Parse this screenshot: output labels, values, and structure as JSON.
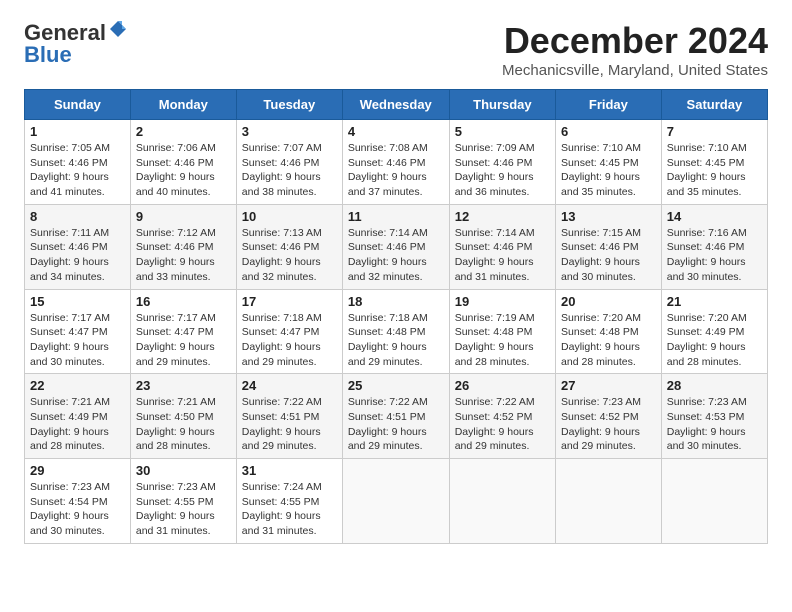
{
  "logo": {
    "general": "General",
    "blue": "Blue"
  },
  "title": "December 2024",
  "subtitle": "Mechanicsville, Maryland, United States",
  "days_of_week": [
    "Sunday",
    "Monday",
    "Tuesday",
    "Wednesday",
    "Thursday",
    "Friday",
    "Saturday"
  ],
  "weeks": [
    [
      {
        "num": "1",
        "sunrise": "Sunrise: 7:05 AM",
        "sunset": "Sunset: 4:46 PM",
        "daylight": "Daylight: 9 hours and 41 minutes."
      },
      {
        "num": "2",
        "sunrise": "Sunrise: 7:06 AM",
        "sunset": "Sunset: 4:46 PM",
        "daylight": "Daylight: 9 hours and 40 minutes."
      },
      {
        "num": "3",
        "sunrise": "Sunrise: 7:07 AM",
        "sunset": "Sunset: 4:46 PM",
        "daylight": "Daylight: 9 hours and 38 minutes."
      },
      {
        "num": "4",
        "sunrise": "Sunrise: 7:08 AM",
        "sunset": "Sunset: 4:46 PM",
        "daylight": "Daylight: 9 hours and 37 minutes."
      },
      {
        "num": "5",
        "sunrise": "Sunrise: 7:09 AM",
        "sunset": "Sunset: 4:46 PM",
        "daylight": "Daylight: 9 hours and 36 minutes."
      },
      {
        "num": "6",
        "sunrise": "Sunrise: 7:10 AM",
        "sunset": "Sunset: 4:45 PM",
        "daylight": "Daylight: 9 hours and 35 minutes."
      },
      {
        "num": "7",
        "sunrise": "Sunrise: 7:10 AM",
        "sunset": "Sunset: 4:45 PM",
        "daylight": "Daylight: 9 hours and 35 minutes."
      }
    ],
    [
      {
        "num": "8",
        "sunrise": "Sunrise: 7:11 AM",
        "sunset": "Sunset: 4:46 PM",
        "daylight": "Daylight: 9 hours and 34 minutes."
      },
      {
        "num": "9",
        "sunrise": "Sunrise: 7:12 AM",
        "sunset": "Sunset: 4:46 PM",
        "daylight": "Daylight: 9 hours and 33 minutes."
      },
      {
        "num": "10",
        "sunrise": "Sunrise: 7:13 AM",
        "sunset": "Sunset: 4:46 PM",
        "daylight": "Daylight: 9 hours and 32 minutes."
      },
      {
        "num": "11",
        "sunrise": "Sunrise: 7:14 AM",
        "sunset": "Sunset: 4:46 PM",
        "daylight": "Daylight: 9 hours and 32 minutes."
      },
      {
        "num": "12",
        "sunrise": "Sunrise: 7:14 AM",
        "sunset": "Sunset: 4:46 PM",
        "daylight": "Daylight: 9 hours and 31 minutes."
      },
      {
        "num": "13",
        "sunrise": "Sunrise: 7:15 AM",
        "sunset": "Sunset: 4:46 PM",
        "daylight": "Daylight: 9 hours and 30 minutes."
      },
      {
        "num": "14",
        "sunrise": "Sunrise: 7:16 AM",
        "sunset": "Sunset: 4:46 PM",
        "daylight": "Daylight: 9 hours and 30 minutes."
      }
    ],
    [
      {
        "num": "15",
        "sunrise": "Sunrise: 7:17 AM",
        "sunset": "Sunset: 4:47 PM",
        "daylight": "Daylight: 9 hours and 30 minutes."
      },
      {
        "num": "16",
        "sunrise": "Sunrise: 7:17 AM",
        "sunset": "Sunset: 4:47 PM",
        "daylight": "Daylight: 9 hours and 29 minutes."
      },
      {
        "num": "17",
        "sunrise": "Sunrise: 7:18 AM",
        "sunset": "Sunset: 4:47 PM",
        "daylight": "Daylight: 9 hours and 29 minutes."
      },
      {
        "num": "18",
        "sunrise": "Sunrise: 7:18 AM",
        "sunset": "Sunset: 4:48 PM",
        "daylight": "Daylight: 9 hours and 29 minutes."
      },
      {
        "num": "19",
        "sunrise": "Sunrise: 7:19 AM",
        "sunset": "Sunset: 4:48 PM",
        "daylight": "Daylight: 9 hours and 28 minutes."
      },
      {
        "num": "20",
        "sunrise": "Sunrise: 7:20 AM",
        "sunset": "Sunset: 4:48 PM",
        "daylight": "Daylight: 9 hours and 28 minutes."
      },
      {
        "num": "21",
        "sunrise": "Sunrise: 7:20 AM",
        "sunset": "Sunset: 4:49 PM",
        "daylight": "Daylight: 9 hours and 28 minutes."
      }
    ],
    [
      {
        "num": "22",
        "sunrise": "Sunrise: 7:21 AM",
        "sunset": "Sunset: 4:49 PM",
        "daylight": "Daylight: 9 hours and 28 minutes."
      },
      {
        "num": "23",
        "sunrise": "Sunrise: 7:21 AM",
        "sunset": "Sunset: 4:50 PM",
        "daylight": "Daylight: 9 hours and 28 minutes."
      },
      {
        "num": "24",
        "sunrise": "Sunrise: 7:22 AM",
        "sunset": "Sunset: 4:51 PM",
        "daylight": "Daylight: 9 hours and 29 minutes."
      },
      {
        "num": "25",
        "sunrise": "Sunrise: 7:22 AM",
        "sunset": "Sunset: 4:51 PM",
        "daylight": "Daylight: 9 hours and 29 minutes."
      },
      {
        "num": "26",
        "sunrise": "Sunrise: 7:22 AM",
        "sunset": "Sunset: 4:52 PM",
        "daylight": "Daylight: 9 hours and 29 minutes."
      },
      {
        "num": "27",
        "sunrise": "Sunrise: 7:23 AM",
        "sunset": "Sunset: 4:52 PM",
        "daylight": "Daylight: 9 hours and 29 minutes."
      },
      {
        "num": "28",
        "sunrise": "Sunrise: 7:23 AM",
        "sunset": "Sunset: 4:53 PM",
        "daylight": "Daylight: 9 hours and 30 minutes."
      }
    ],
    [
      {
        "num": "29",
        "sunrise": "Sunrise: 7:23 AM",
        "sunset": "Sunset: 4:54 PM",
        "daylight": "Daylight: 9 hours and 30 minutes."
      },
      {
        "num": "30",
        "sunrise": "Sunrise: 7:23 AM",
        "sunset": "Sunset: 4:55 PM",
        "daylight": "Daylight: 9 hours and 31 minutes."
      },
      {
        "num": "31",
        "sunrise": "Sunrise: 7:24 AM",
        "sunset": "Sunset: 4:55 PM",
        "daylight": "Daylight: 9 hours and 31 minutes."
      },
      null,
      null,
      null,
      null
    ]
  ]
}
